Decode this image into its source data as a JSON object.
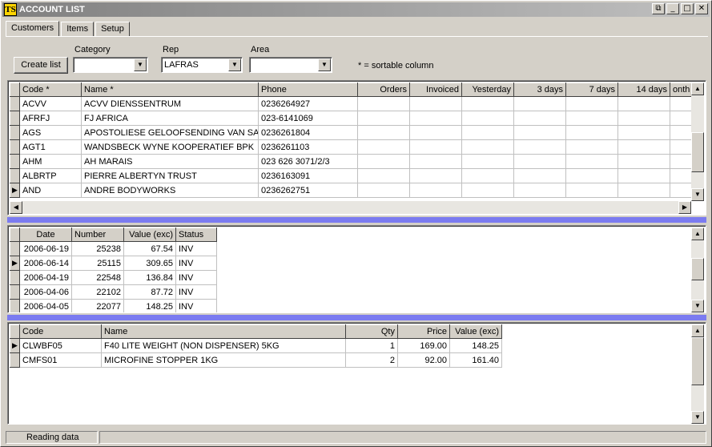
{
  "window": {
    "title": "ACCOUNT LIST",
    "app_icon_text": "TS",
    "buttons": [
      "restore",
      "minimize",
      "maximize",
      "close"
    ]
  },
  "tabs": [
    {
      "label": "Customers",
      "active": true
    },
    {
      "label": "Items",
      "active": false
    },
    {
      "label": "Setup",
      "active": false
    }
  ],
  "filters": {
    "create_list_label": "Create list",
    "category_label": "Category",
    "category_value": "",
    "rep_label": "Rep",
    "rep_value": "LAFRAS",
    "area_label": "Area",
    "area_value": "",
    "sortable_note": "* = sortable column"
  },
  "accounts": {
    "columns": [
      "Code *",
      "Name *",
      "Phone",
      "Orders",
      "Invoiced",
      "Yesterday",
      "3 days",
      "7 days",
      "14 days",
      "onth"
    ],
    "rows": [
      {
        "code": "ACVV",
        "name": "ACVV DIENSSENTRUM",
        "phone": "0236264927",
        "selected": false
      },
      {
        "code": "AFRFJ",
        "name": "FJ AFRICA",
        "phone": "023-6141069",
        "selected": false
      },
      {
        "code": "AGS",
        "name": "APOSTOLIESE GELOOFSENDING VAN SA",
        "phone": "0236261804",
        "selected": false
      },
      {
        "code": "AGT1",
        "name": "WANDSBECK WYNE KOOPERATIEF BPK",
        "phone": "0236261103",
        "selected": false
      },
      {
        "code": "AHM",
        "name": "AH MARAIS",
        "phone": "023 626 3071/2/3",
        "selected": false
      },
      {
        "code": "ALBRTP",
        "name": "PIERRE ALBERTYN TRUST",
        "phone": "0236163091",
        "selected": false
      },
      {
        "code": "AND",
        "name": "ANDRE BODYWORKS",
        "phone": "0236262751",
        "selected": true
      }
    ]
  },
  "invoices": {
    "columns": [
      "Date",
      "Number",
      "Value (exc)",
      "Status"
    ],
    "rows": [
      {
        "date": "2006-06-19",
        "number": "25238",
        "value": "67.54",
        "status": "INV",
        "selected": false
      },
      {
        "date": "2006-06-14",
        "number": "25115",
        "value": "309.65",
        "status": "INV",
        "selected": true
      },
      {
        "date": "2006-04-19",
        "number": "22548",
        "value": "136.84",
        "status": "INV",
        "selected": false
      },
      {
        "date": "2006-04-06",
        "number": "22102",
        "value": "87.72",
        "status": "INV",
        "selected": false
      },
      {
        "date": "2006-04-05",
        "number": "22077",
        "value": "148.25",
        "status": "INV",
        "selected": false
      }
    ]
  },
  "lines": {
    "columns": [
      "Code",
      "Name",
      "Qty",
      "Price",
      "Value (exc)"
    ],
    "rows": [
      {
        "code": "CLWBF05",
        "name": "F40 LITE WEIGHT (NON DISPENSER) 5KG",
        "qty": "1",
        "price": "169.00",
        "value": "148.25",
        "selected": true
      },
      {
        "code": "CMFS01",
        "name": "MICROFINE STOPPER 1KG",
        "qty": "2",
        "price": "92.00",
        "value": "161.40",
        "selected": false
      }
    ]
  },
  "status": {
    "text": "Reading data"
  },
  "colors": {
    "splitter": "#7b7bf0",
    "face": "#d4d0c8"
  }
}
